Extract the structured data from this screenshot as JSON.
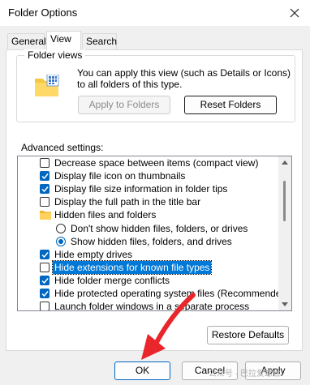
{
  "window": {
    "title": "Folder Options",
    "close_icon": "close-icon"
  },
  "tabs": [
    {
      "label": "General",
      "active": false
    },
    {
      "label": "View",
      "active": true
    },
    {
      "label": "Search",
      "active": false
    }
  ],
  "folder_views": {
    "label": "Folder views",
    "description": "You can apply this view (such as Details or Icons) to all folders of this type.",
    "apply_button": "Apply to Folders",
    "reset_button": "Reset Folders",
    "icon": "folder-grid-icon"
  },
  "advanced": {
    "label": "Advanced settings:",
    "items": [
      {
        "type": "checkbox",
        "label": "Decrease space between items (compact view)",
        "checked": false
      },
      {
        "type": "checkbox",
        "label": "Display file icon on thumbnails",
        "checked": true
      },
      {
        "type": "checkbox",
        "label": "Display file size information in folder tips",
        "checked": true
      },
      {
        "type": "checkbox",
        "label": "Display the full path in the title bar",
        "checked": false
      },
      {
        "type": "folder",
        "label": "Hidden files and folders"
      },
      {
        "type": "radio",
        "label": "Don't show hidden files, folders, or drives",
        "checked": false
      },
      {
        "type": "radio",
        "label": "Show hidden files, folders, and drives",
        "checked": true
      },
      {
        "type": "checkbox",
        "label": "Hide empty drives",
        "checked": true
      },
      {
        "type": "checkbox",
        "label": "Hide extensions for known file types",
        "checked": false,
        "selected": true
      },
      {
        "type": "checkbox",
        "label": "Hide folder merge conflicts",
        "checked": true
      },
      {
        "type": "checkbox",
        "label": "Hide protected operating system files (Recommended)",
        "checked": true
      },
      {
        "type": "checkbox",
        "label": "Launch folder windows in a separate process",
        "checked": false
      }
    ]
  },
  "buttons": {
    "restore_defaults": "Restore Defaults",
    "ok": "OK",
    "cancel": "Cancel",
    "apply": "Apply"
  },
  "annotation": {
    "arrow_color": "#e8262b"
  },
  "watermark": "公众号 · 巴拉爱螺丝"
}
